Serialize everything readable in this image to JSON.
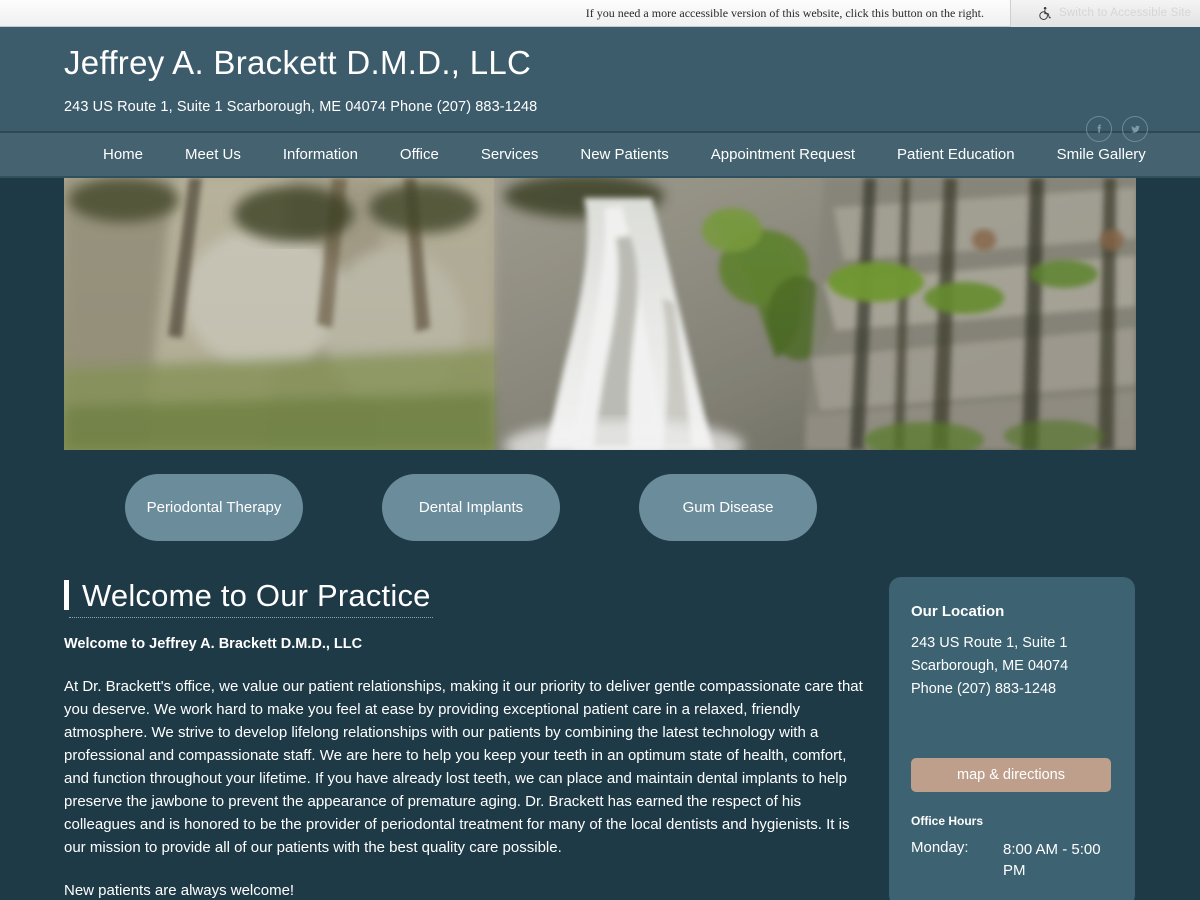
{
  "accessibility_bar": {
    "note": "If you need a more accessible version of this website, click this button on the right.",
    "button_label": "Switch to Accessible Site",
    "button_icon": "wheelchair-icon"
  },
  "header": {
    "title": "Jeffrey A. Brackett D.M.D., LLC",
    "address_line": "243 US Route 1, Suite 1 Scarborough, ME 04074  Phone (207) 883-1248",
    "social": [
      {
        "name": "facebook-icon",
        "label": "f"
      },
      {
        "name": "twitter-icon",
        "label": "t"
      }
    ]
  },
  "nav": {
    "items": [
      {
        "label": "Home"
      },
      {
        "label": "Meet Us"
      },
      {
        "label": "Information"
      },
      {
        "label": "Office"
      },
      {
        "label": "Services"
      },
      {
        "label": "New Patients"
      },
      {
        "label": "Appointment Request"
      },
      {
        "label": "Patient Education"
      },
      {
        "label": "Smile Gallery"
      }
    ]
  },
  "hero": {
    "alt": "Waterfall cascading over a mossy rock cliff surrounded by green foliage"
  },
  "service_pills": [
    {
      "label": "Periodontal Therapy"
    },
    {
      "label": "Dental Implants"
    },
    {
      "label": "Gum Disease"
    }
  ],
  "main": {
    "page_title": "Welcome to Our Practice",
    "subhead": "Welcome to Jeffrey A. Brackett D.M.D., LLC",
    "paragraph_1": "At Dr. Brackett's office, we value our patient relationships, making it our priority to deliver gentle compassionate care that you deserve. We work hard to make you feel at ease by providing exceptional patient care in a relaxed, friendly atmosphere. We strive to develop lifelong relationships with our patients by combining the latest technology with a professional and compassionate staff. We are here to help you keep your teeth in an optimum state of health, comfort, and function throughout your lifetime. If you have already lost teeth, we can place and maintain dental implants to help preserve the jawbone to prevent the appearance of premature aging. Dr. Brackett has earned the respect of his colleagues and is honored to be the provider of periodontal treatment for many of the local dentists and hygienists. It is our mission to provide all of our patients with the best quality care possible.",
    "paragraph_2": "New patients are always welcome!"
  },
  "sidebar": {
    "location_title": "Our Location",
    "address_1": "243 US Route 1, Suite 1",
    "address_2": "Scarborough, ME 04074",
    "phone": "Phone (207) 883-1248",
    "map_button": "map & directions",
    "hours_title": "Office Hours",
    "hours": [
      {
        "day": "Monday:",
        "value": "8:00 AM - 5:00 PM"
      }
    ]
  },
  "colors": {
    "page_background": "#1e3a47",
    "header_background": "#3d5c6b",
    "nav_background": "#44626f",
    "pill_background": "#6b8c9b",
    "sidebar_background": "#3d6272",
    "map_button_background": "#bd9f8b",
    "text": "#ffffff"
  }
}
